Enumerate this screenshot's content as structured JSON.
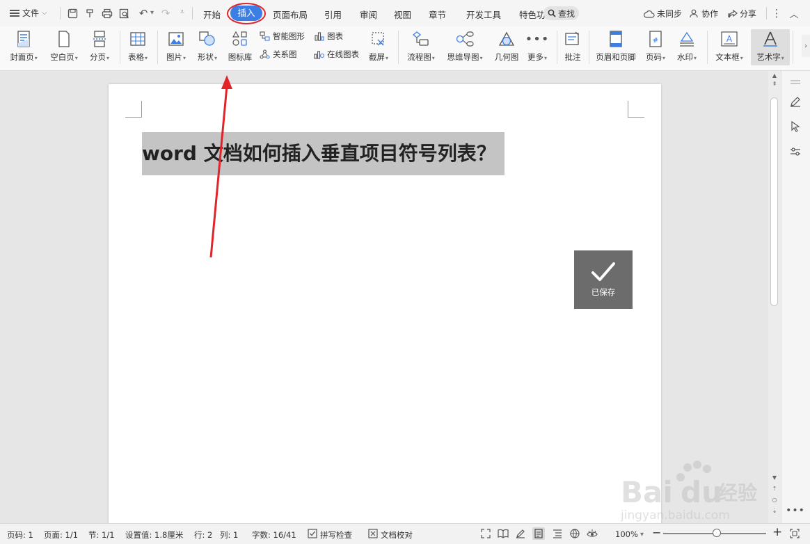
{
  "menubar": {
    "file_label": "文件",
    "tabs": [
      "开始",
      "插入",
      "页面布局",
      "引用",
      "审阅",
      "视图",
      "章节",
      "开发工具",
      "特色功能"
    ],
    "active_tab": "插入",
    "search_label": "查找",
    "right": {
      "sync": "未同步",
      "collab": "协作",
      "share": "分享"
    }
  },
  "ribbon": {
    "cover_page": "封面页",
    "blank_page": "空白页",
    "page_break": "分页",
    "table": "表格",
    "picture": "图片",
    "shape": "形状",
    "icon_library": "图标库",
    "smart_graphic": "智能图形",
    "chart": "图表",
    "relation_chart": "关系图",
    "online_chart": "在线图表",
    "screenshot": "截屏",
    "flowchart": "流程图",
    "mindmap": "思维导图",
    "geometry": "几何图",
    "more": "更多",
    "comment": "批注",
    "header_footer": "页眉和页脚",
    "page_number": "页码",
    "watermark": "水印",
    "textbox": "文本框",
    "wordart": "艺术字"
  },
  "document": {
    "title": "word 文档如何插入垂直项目符号列表？",
    "saved_label": "已保存"
  },
  "status": {
    "page_code": "页码: 1",
    "page": "页面: 1/1",
    "section": "节: 1/1",
    "setting": "设置值: 1.8厘米",
    "row": "行: 2",
    "col": "列: 1",
    "words": "字数: 16/41",
    "spell_check": "拼写检查",
    "doc_proof": "文档校对",
    "zoom": "100%"
  },
  "watermark": {
    "brand": "Bai",
    "brand_cn": "经验",
    "url": "jingyan.baidu.com"
  },
  "colors": {
    "accent": "#3d7ee4",
    "highlight_ring": "#e0242a",
    "arrow": "#e0242a",
    "saved_bg": "#6c6c6c"
  }
}
